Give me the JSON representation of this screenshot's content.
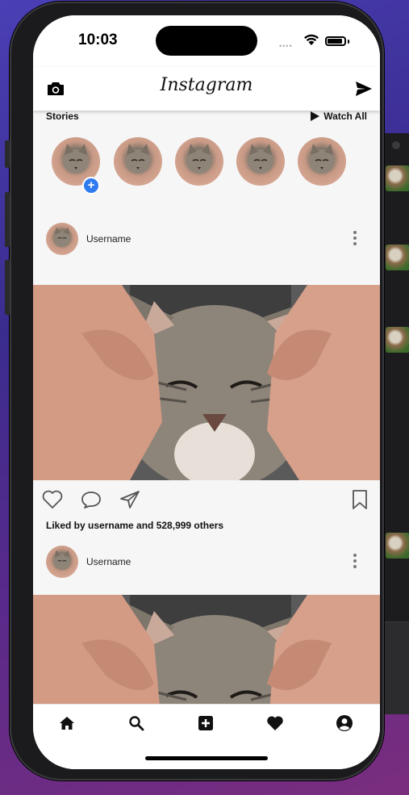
{
  "status_bar": {
    "time": "10:03",
    "signal": "••••"
  },
  "app": {
    "title": "Instagram"
  },
  "stories": {
    "heading": "Stories",
    "watch_all": "Watch All",
    "add_badge": "+",
    "items": [
      {
        "name": "your-story"
      },
      {
        "name": "story-2"
      },
      {
        "name": "story-3"
      },
      {
        "name": "story-4"
      },
      {
        "name": "story-5"
      }
    ]
  },
  "posts": [
    {
      "username": "Username",
      "likes_text": "Liked by username and 528,999 others"
    },
    {
      "username": "Username"
    }
  ],
  "tabs": [
    "home-icon",
    "search-icon",
    "add-post-icon",
    "heart-icon",
    "profile-icon"
  ],
  "colors": {
    "accent_blue": "#2f7bf0",
    "background": "#f6f6f6",
    "tabbar": "#ffffff"
  }
}
